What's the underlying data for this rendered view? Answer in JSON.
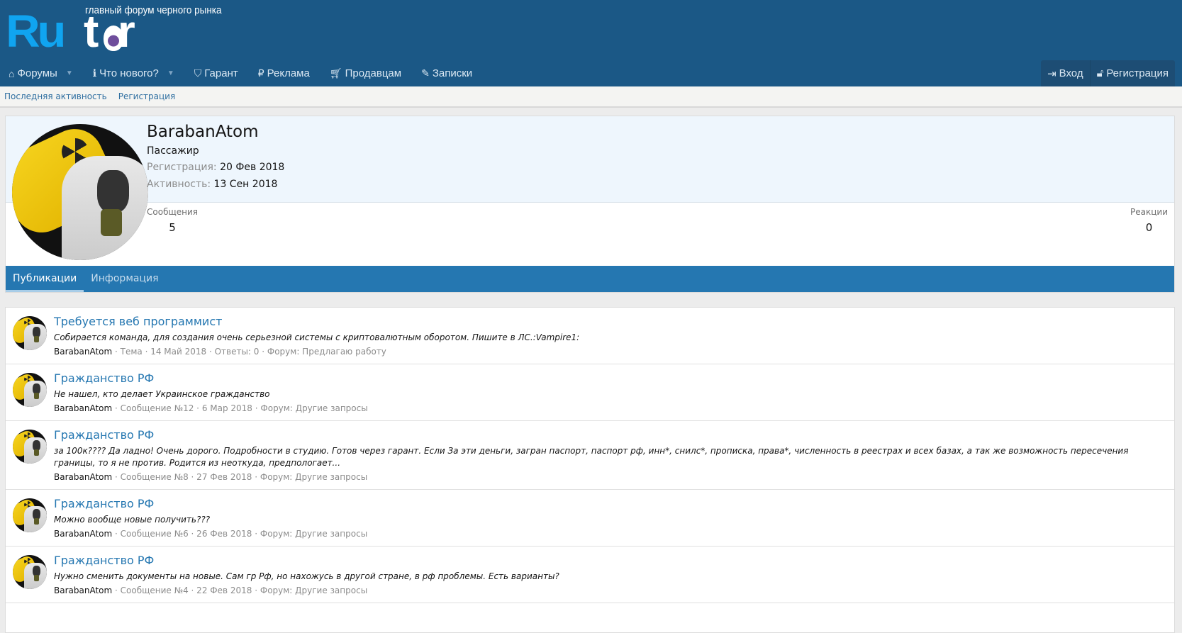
{
  "header": {
    "logo_text": "Rutor",
    "tagline": "главный форум черного рынка",
    "nav": [
      {
        "label": "Форумы",
        "icon": "home-icon",
        "dropdown": true
      },
      {
        "label": "Что нового?",
        "icon": "info-icon",
        "dropdown": true
      },
      {
        "label": "Гарант",
        "icon": "shield-icon"
      },
      {
        "label": "Реклама",
        "icon": "ruble-icon"
      },
      {
        "label": "Продавцам",
        "icon": "cart-icon"
      },
      {
        "label": "Записки",
        "icon": "edit-icon"
      }
    ],
    "login": "Вход",
    "register": "Регистрация"
  },
  "subnav": [
    "Последняя активность",
    "Регистрация"
  ],
  "profile": {
    "name": "BarabanAtom",
    "title": "Пассажир",
    "reg_label": "Регистрация:",
    "reg_value": "20 Фев 2018",
    "act_label": "Активность:",
    "act_value": "13 Сен 2018",
    "messages_label": "Сообщения",
    "messages": "5",
    "reactions_label": "Реакции",
    "reactions": "0",
    "tabs": [
      "Публикации",
      "Информация"
    ]
  },
  "posts": [
    {
      "title": "Требуется веб программист",
      "body": "Собирается команда, для создания очень серьезной системы с криптовалютным оборотом. Пишите в ЛС.:Vampire1:",
      "user": "BarabanAtom",
      "meta": " · Тема · 14 Май 2018 · Ответы: 0 · ",
      "forum": "Форум: Предлагаю работу"
    },
    {
      "title": "Гражданство РФ",
      "body": "Не нашел, кто делает Украинское гражданство",
      "user": "BarabanAtom",
      "meta": " · Сообщение №12 · 6 Мар 2018 · ",
      "forum": "Форум: Другие запросы"
    },
    {
      "title": "Гражданство РФ",
      "body": "за 100к???? Да ладно! Очень дорого. Подробности в студию. Готов через гарант. Если За эти деньги, загран паспорт, паспорт рф, инн*, снилс*, прописка, права*, численность в реестрах и всех базах, а так же возможность пересечения границы, то я не против. Родится из неоткуда, предпологает...",
      "user": "BarabanAtom",
      "meta": " · Сообщение №8 · 27 Фев 2018 · ",
      "forum": "Форум: Другие запросы"
    },
    {
      "title": "Гражданство РФ",
      "body": "Можно вообще новые получить???",
      "user": "BarabanAtom",
      "meta": " · Сообщение №6 · 26 Фев 2018 · ",
      "forum": "Форум: Другие запросы"
    },
    {
      "title": "Гражданство РФ",
      "body": "Нужно сменить документы на новые. Сам гр Рф, но нахожусь в другой стране, в рф проблемы. Есть варианты?",
      "user": "BarabanAtom",
      "meta": " · Сообщение №4 · 22 Фев 2018 · ",
      "forum": "Форум: Другие запросы"
    }
  ],
  "colors": {
    "header": "#1b5886",
    "accent": "#2577b1"
  }
}
